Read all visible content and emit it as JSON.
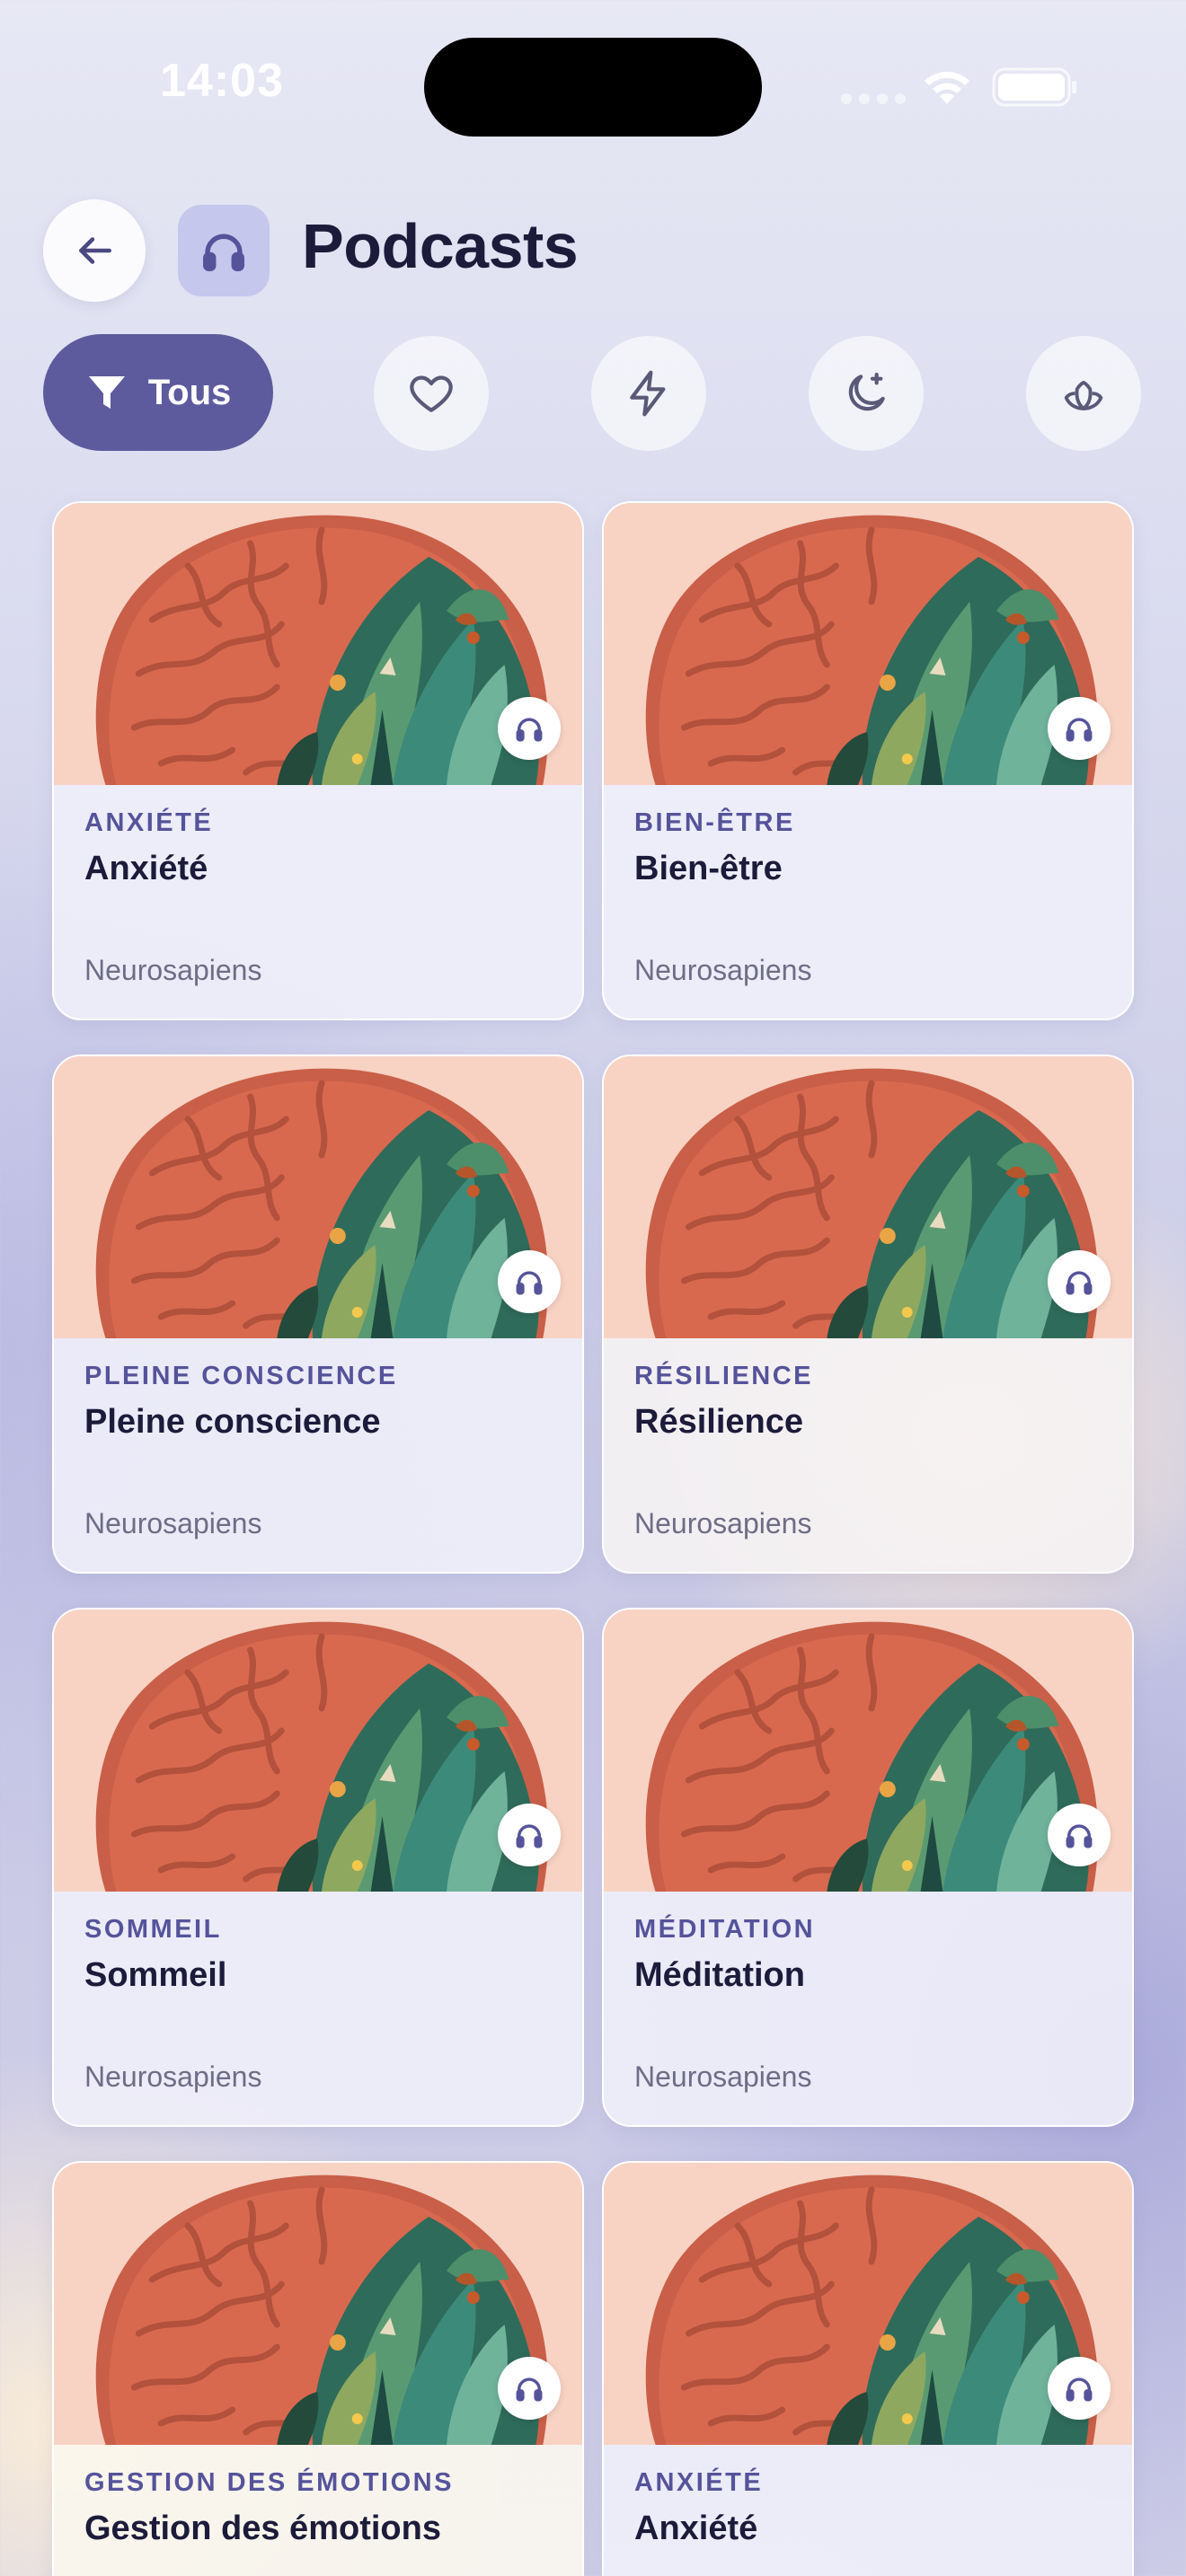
{
  "status_bar": {
    "time": "14:03"
  },
  "header": {
    "back_icon": "arrow-left-icon",
    "section_icon": "headphones-icon",
    "title": "Podcasts"
  },
  "filters": {
    "all_label": "Tous",
    "all_icon": "filter-icon",
    "chips": [
      {
        "name": "favorites",
        "icon": "heart-icon"
      },
      {
        "name": "energy",
        "icon": "lightning-icon"
      },
      {
        "name": "sleep",
        "icon": "moon-icon"
      },
      {
        "name": "meditation",
        "icon": "lotus-icon"
      }
    ]
  },
  "colors": {
    "accent": "#5d5b9d",
    "category": "#55539a",
    "title": "#1c1b3a"
  },
  "cards": [
    {
      "category": "ANXIÉTÉ",
      "title": "Anxiété",
      "author": "Neurosapiens"
    },
    {
      "category": "BIEN-ÊTRE",
      "title": "Bien-être",
      "author": "Neurosapiens"
    },
    {
      "category": "PLEINE CONSCIENCE",
      "title": "Pleine conscience",
      "author": "Neurosapiens"
    },
    {
      "category": "RÉSILIENCE",
      "title": "Résilience",
      "author": "Neurosapiens"
    },
    {
      "category": "SOMMEIL",
      "title": "Sommeil",
      "author": "Neurosapiens"
    },
    {
      "category": "MÉDITATION",
      "title": "Méditation",
      "author": "Neurosapiens"
    },
    {
      "category": "GESTION DES ÉMOTIONS",
      "title": "Gestion des émotions",
      "author": ""
    },
    {
      "category": "ANXIÉTÉ",
      "title": "Anxiété",
      "author": ""
    }
  ]
}
